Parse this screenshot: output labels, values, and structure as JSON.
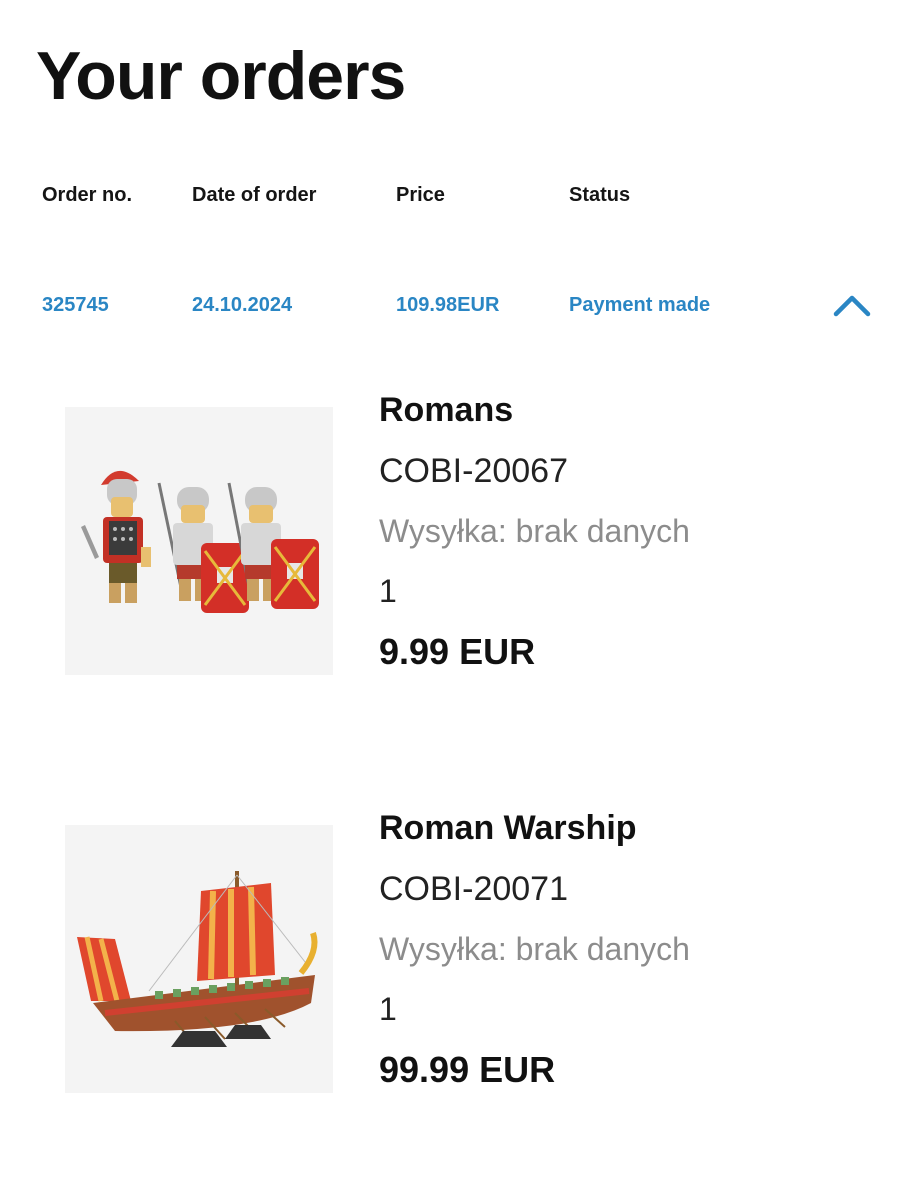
{
  "page": {
    "title": "Your orders"
  },
  "orders_table": {
    "headers": {
      "order_no": "Order no.",
      "date": "Date of order",
      "price": "Price",
      "status": "Status"
    },
    "rows": [
      {
        "order_no": "325745",
        "date": "24.10.2024",
        "price": "109.98EUR",
        "status": "Payment made",
        "expanded": true,
        "toggle_icon": "chevron-up-icon"
      }
    ]
  },
  "colors": {
    "link": "#2a86c4",
    "muted": "#8c8c8c",
    "text": "#111111"
  },
  "products": [
    {
      "name": "Romans",
      "sku": "COBI-20067",
      "shipping": "Wysyłka: brak danych",
      "quantity": "1",
      "price": "9.99 EUR",
      "image": "roman-soldiers-figures"
    },
    {
      "name": "Roman Warship",
      "sku": "COBI-20071",
      "shipping": "Wysyłka: brak danych",
      "quantity": "1",
      "price": "99.99 EUR",
      "image": "roman-warship-model"
    }
  ]
}
